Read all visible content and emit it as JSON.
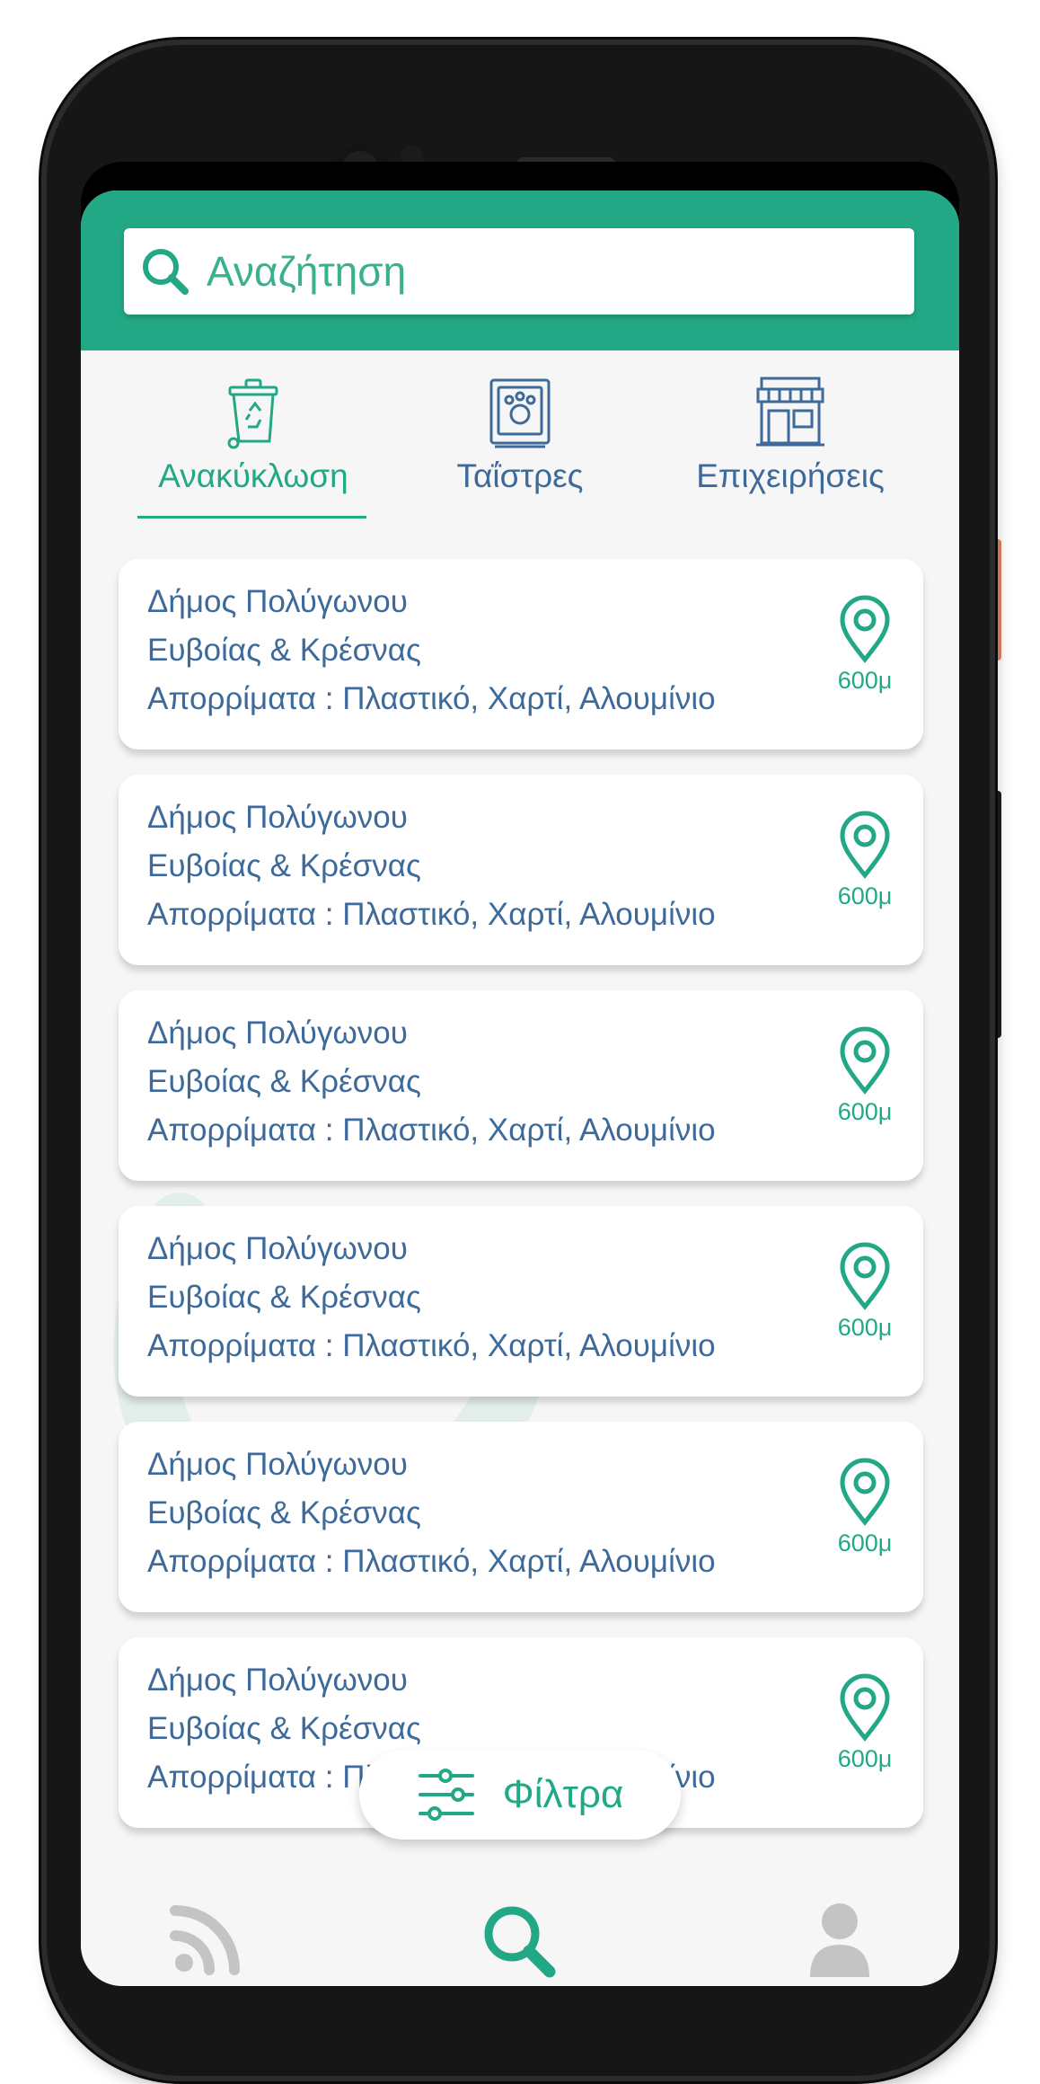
{
  "search": {
    "placeholder": "Αναζήτηση"
  },
  "categories": [
    {
      "label": "Ανακύκλωση",
      "icon": "recycle-bin-icon",
      "active": true
    },
    {
      "label": "Ταΐστρες",
      "icon": "pet-feeder-icon",
      "active": false
    },
    {
      "label": "Επιχειρήσεις",
      "icon": "storefront-icon",
      "active": false
    }
  ],
  "results": [
    {
      "name": "Δήμος Πολύγωνου",
      "address": "Ευβοίας & Κρέσνας",
      "waste": "Απορρίματα : Πλαστικό, Χαρτί, Αλουμίνιο",
      "distance": "600μ"
    },
    {
      "name": "Δήμος Πολύγωνου",
      "address": "Ευβοίας & Κρέσνας",
      "waste": "Απορρίματα : Πλαστικό, Χαρτί, Αλουμίνιο",
      "distance": "600μ"
    },
    {
      "name": "Δήμος Πολύγωνου",
      "address": "Ευβοίας & Κρέσνας",
      "waste": "Απορρίματα : Πλαστικό, Χαρτί, Αλουμίνιο",
      "distance": "600μ"
    },
    {
      "name": "Δήμος Πολύγωνου",
      "address": "Ευβοίας & Κρέσνας",
      "waste": "Απορρίματα : Πλαστικό, Χαρτί, Αλουμίνιο",
      "distance": "600μ"
    },
    {
      "name": "Δήμος Πολύγωνου",
      "address": "Ευβοίας & Κρέσνας",
      "waste": "Απορρίματα : Πλαστικό, Χαρτί, Αλουμίνιο",
      "distance": "600μ"
    },
    {
      "name": "Δήμος Πολύγωνου",
      "address": "Ευβοίας & Κρέσνας",
      "waste": "Απορρίματα : Πλαστικό, Χαρτί, Αλουμίνιο",
      "distance": "600μ"
    }
  ],
  "filter_button": {
    "label": "Φίλτρα",
    "icon": "sliders-icon"
  },
  "bottom_nav": [
    {
      "icon": "feed-icon",
      "active": false
    },
    {
      "icon": "search-icon",
      "active": true
    },
    {
      "icon": "profile-icon",
      "active": false
    }
  ],
  "colors": {
    "accent": "#22a885",
    "text": "#3d6a9b",
    "inactive_icon": "#c4c4c4",
    "background": "#f6f6f6"
  }
}
